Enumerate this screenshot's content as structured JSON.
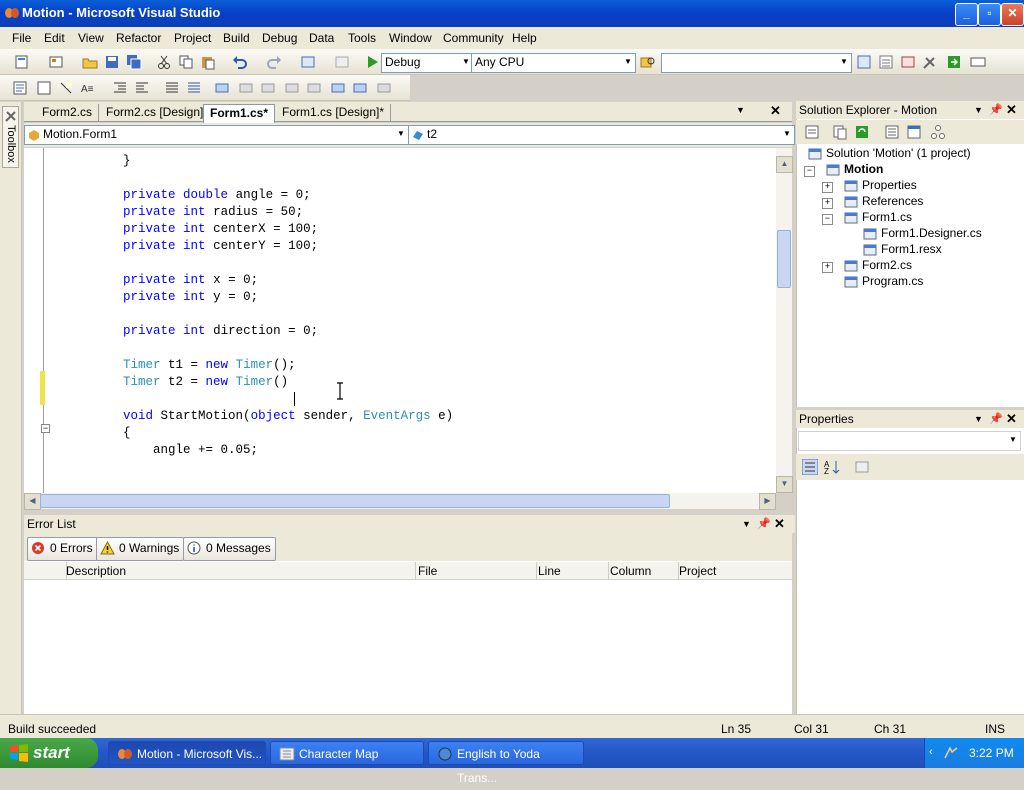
{
  "window": {
    "title": "Motion - Microsoft Visual Studio"
  },
  "menu": [
    "File",
    "Edit",
    "View",
    "Refactor",
    "Project",
    "Build",
    "Debug",
    "Data",
    "Tools",
    "Window",
    "Community",
    "Help"
  ],
  "toolbar": {
    "config": "Debug",
    "platform": "Any CPU",
    "find_value": ""
  },
  "tabs": [
    "Form2.cs",
    "Form2.cs [Design]",
    "Form1.cs*",
    "Form1.cs [Design]*"
  ],
  "active_tab": "Form1.cs*",
  "toolbox_label": "Toolbox",
  "nav": {
    "class_combo": "Motion.Form1",
    "member_combo": "t2"
  },
  "code": {
    "lines": [
      {
        "line": 1,
        "parts": [
          {
            "t": "        }",
            "c": ""
          }
        ]
      },
      {
        "line": 3,
        "parts": [
          {
            "t": "        ",
            "c": ""
          },
          {
            "t": "private",
            "c": "kw"
          },
          {
            "t": " ",
            "c": ""
          },
          {
            "t": "double",
            "c": "kw"
          },
          {
            "t": " angle = 0;",
            "c": ""
          }
        ]
      },
      {
        "line": 4,
        "parts": [
          {
            "t": "        ",
            "c": ""
          },
          {
            "t": "private",
            "c": "kw"
          },
          {
            "t": " ",
            "c": ""
          },
          {
            "t": "int",
            "c": "kw"
          },
          {
            "t": " radius = 50;",
            "c": ""
          }
        ]
      },
      {
        "line": 5,
        "parts": [
          {
            "t": "        ",
            "c": ""
          },
          {
            "t": "private",
            "c": "kw"
          },
          {
            "t": " ",
            "c": ""
          },
          {
            "t": "int",
            "c": "kw"
          },
          {
            "t": " centerX = 100;",
            "c": ""
          }
        ]
      },
      {
        "line": 6,
        "parts": [
          {
            "t": "        ",
            "c": ""
          },
          {
            "t": "private",
            "c": "kw"
          },
          {
            "t": " ",
            "c": ""
          },
          {
            "t": "int",
            "c": "kw"
          },
          {
            "t": " centerY = 100;",
            "c": ""
          }
        ]
      },
      {
        "line": 8,
        "parts": [
          {
            "t": "        ",
            "c": ""
          },
          {
            "t": "private",
            "c": "kw"
          },
          {
            "t": " ",
            "c": ""
          },
          {
            "t": "int",
            "c": "kw"
          },
          {
            "t": " x = 0;",
            "c": ""
          }
        ]
      },
      {
        "line": 9,
        "parts": [
          {
            "t": "        ",
            "c": ""
          },
          {
            "t": "private",
            "c": "kw"
          },
          {
            "t": " ",
            "c": ""
          },
          {
            "t": "int",
            "c": "kw"
          },
          {
            "t": " y = 0;",
            "c": ""
          }
        ]
      },
      {
        "line": 11,
        "parts": [
          {
            "t": "        ",
            "c": ""
          },
          {
            "t": "private",
            "c": "kw"
          },
          {
            "t": " ",
            "c": ""
          },
          {
            "t": "int",
            "c": "kw"
          },
          {
            "t": " direction = 0;",
            "c": ""
          }
        ]
      },
      {
        "line": 13,
        "parts": [
          {
            "t": "        ",
            "c": ""
          },
          {
            "t": "Timer",
            "c": "ty"
          },
          {
            "t": " t1 = ",
            "c": ""
          },
          {
            "t": "new",
            "c": "kw"
          },
          {
            "t": " ",
            "c": ""
          },
          {
            "t": "Timer",
            "c": "ty"
          },
          {
            "t": "();",
            "c": ""
          }
        ]
      },
      {
        "line": 14,
        "parts": [
          {
            "t": "        ",
            "c": ""
          },
          {
            "t": "Timer",
            "c": "ty"
          },
          {
            "t": " t2 = ",
            "c": ""
          },
          {
            "t": "new",
            "c": "kw"
          },
          {
            "t": " ",
            "c": ""
          },
          {
            "t": "Timer",
            "c": "ty"
          },
          {
            "t": "()",
            "c": ""
          }
        ]
      },
      {
        "line": 16,
        "parts": [
          {
            "t": "        ",
            "c": ""
          },
          {
            "t": "void",
            "c": "kw"
          },
          {
            "t": " StartMotion(",
            "c": ""
          },
          {
            "t": "object",
            "c": "kw"
          },
          {
            "t": " sender, ",
            "c": ""
          },
          {
            "t": "EventArgs",
            "c": "ty"
          },
          {
            "t": " e)",
            "c": ""
          }
        ]
      },
      {
        "line": 17,
        "parts": [
          {
            "t": "        {",
            "c": ""
          }
        ]
      },
      {
        "line": 18,
        "parts": [
          {
            "t": "            angle += 0.05;",
            "c": ""
          }
        ]
      }
    ]
  },
  "solution_explorer": {
    "title": "Solution Explorer - Motion",
    "items": [
      {
        "label": "Solution 'Motion' (1 project)",
        "level": 0,
        "icon": "solution-icon"
      },
      {
        "label": "Motion",
        "level": 1,
        "bold": true,
        "icon": "csproject-icon"
      },
      {
        "label": "Properties",
        "level": 2,
        "icon": "properties-folder-icon"
      },
      {
        "label": "References",
        "level": 2,
        "icon": "references-icon"
      },
      {
        "label": "Form1.cs",
        "level": 2,
        "icon": "form-icon"
      },
      {
        "label": "Form1.Designer.cs",
        "level": 3,
        "icon": "csfile-icon"
      },
      {
        "label": "Form1.resx",
        "level": 3,
        "icon": "resx-icon"
      },
      {
        "label": "Form2.cs",
        "level": 2,
        "icon": "form-icon"
      },
      {
        "label": "Program.cs",
        "level": 2,
        "icon": "csfile-icon"
      }
    ]
  },
  "properties_panel": {
    "title": "Properties"
  },
  "error_list": {
    "title": "Error List",
    "errors": "0 Errors",
    "warnings": "0 Warnings",
    "messages": "0 Messages",
    "columns": [
      "Description",
      "File",
      "Line",
      "Column",
      "Project"
    ]
  },
  "status": {
    "text": "Build succeeded",
    "ln": "Ln 35",
    "col": "Col 31",
    "ch": "Ch 31",
    "mode": "INS"
  },
  "taskbar": {
    "start": "start",
    "tasks": [
      "Motion - Microsoft Vis...",
      "Character Map",
      "English to Yoda Trans..."
    ],
    "clock": "3:22 PM"
  },
  "colors": {
    "keyword": "#0000ff",
    "type": "#2b91af",
    "titlebar": "#0a4fd0"
  }
}
